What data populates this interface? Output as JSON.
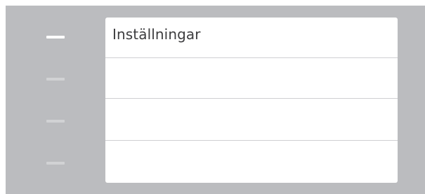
{
  "settings_panel": {
    "title": "Inställningar",
    "rows": [
      "",
      "",
      ""
    ]
  },
  "sidebar": {
    "indicator_count": 4,
    "active_index": 0
  },
  "colors": {
    "background": "#bbbcbf",
    "panel": "#ffffff",
    "active_indicator": "#ffffff",
    "inactive_indicator": "#d1d2d4",
    "divider": "#cfcfd2",
    "title_text": "#3d3d3f"
  }
}
